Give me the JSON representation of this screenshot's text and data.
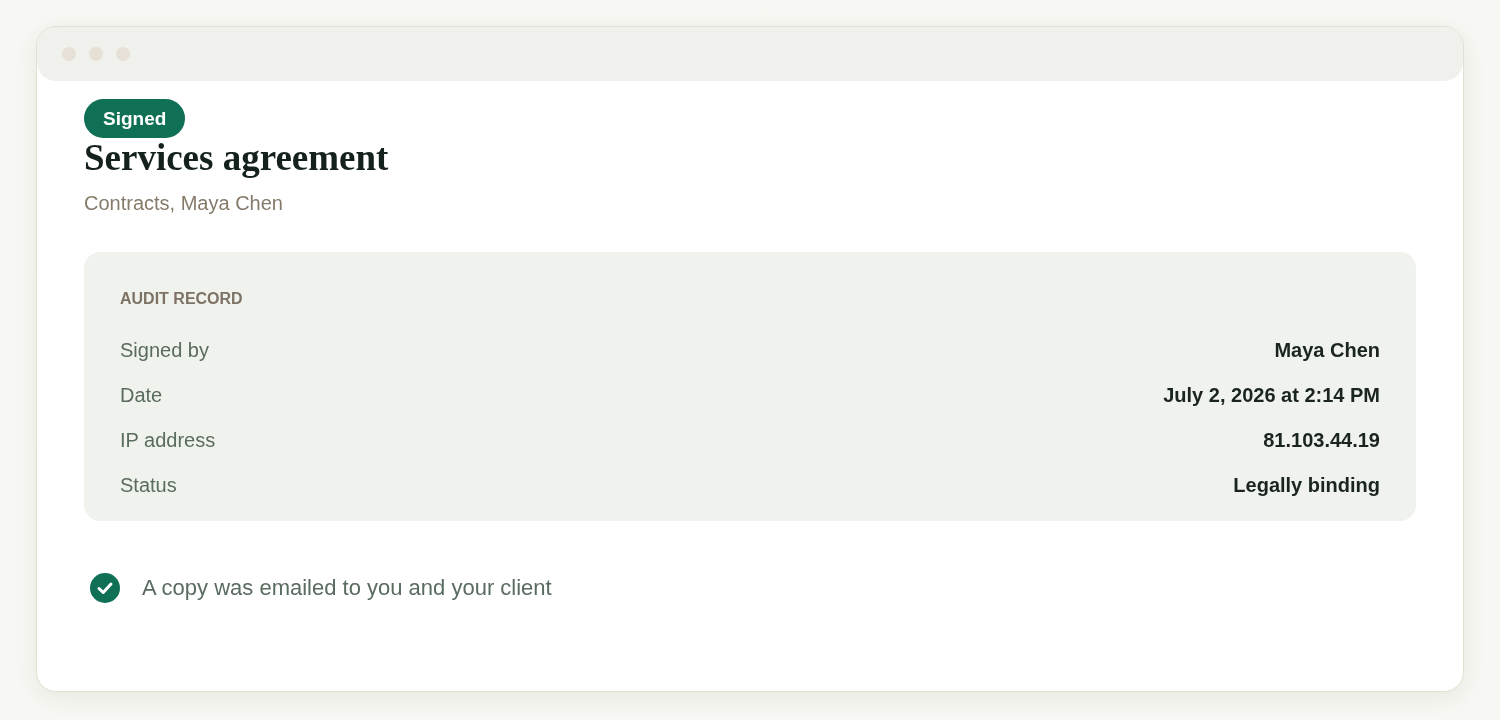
{
  "badge": {
    "label": "Signed"
  },
  "title": "Services agreement",
  "subtitle": "Contracts, Maya Chen",
  "audit": {
    "heading": "AUDIT RECORD",
    "rows": [
      {
        "label": "Signed by",
        "value": "Maya Chen"
      },
      {
        "label": "Date",
        "value": "July 2, 2026 at 2:14 PM"
      },
      {
        "label": "IP address",
        "value": "81.103.44.19"
      },
      {
        "label": "Status",
        "value": "Legally binding"
      }
    ]
  },
  "notice": {
    "text": "A copy was emailed to you and your client"
  }
}
